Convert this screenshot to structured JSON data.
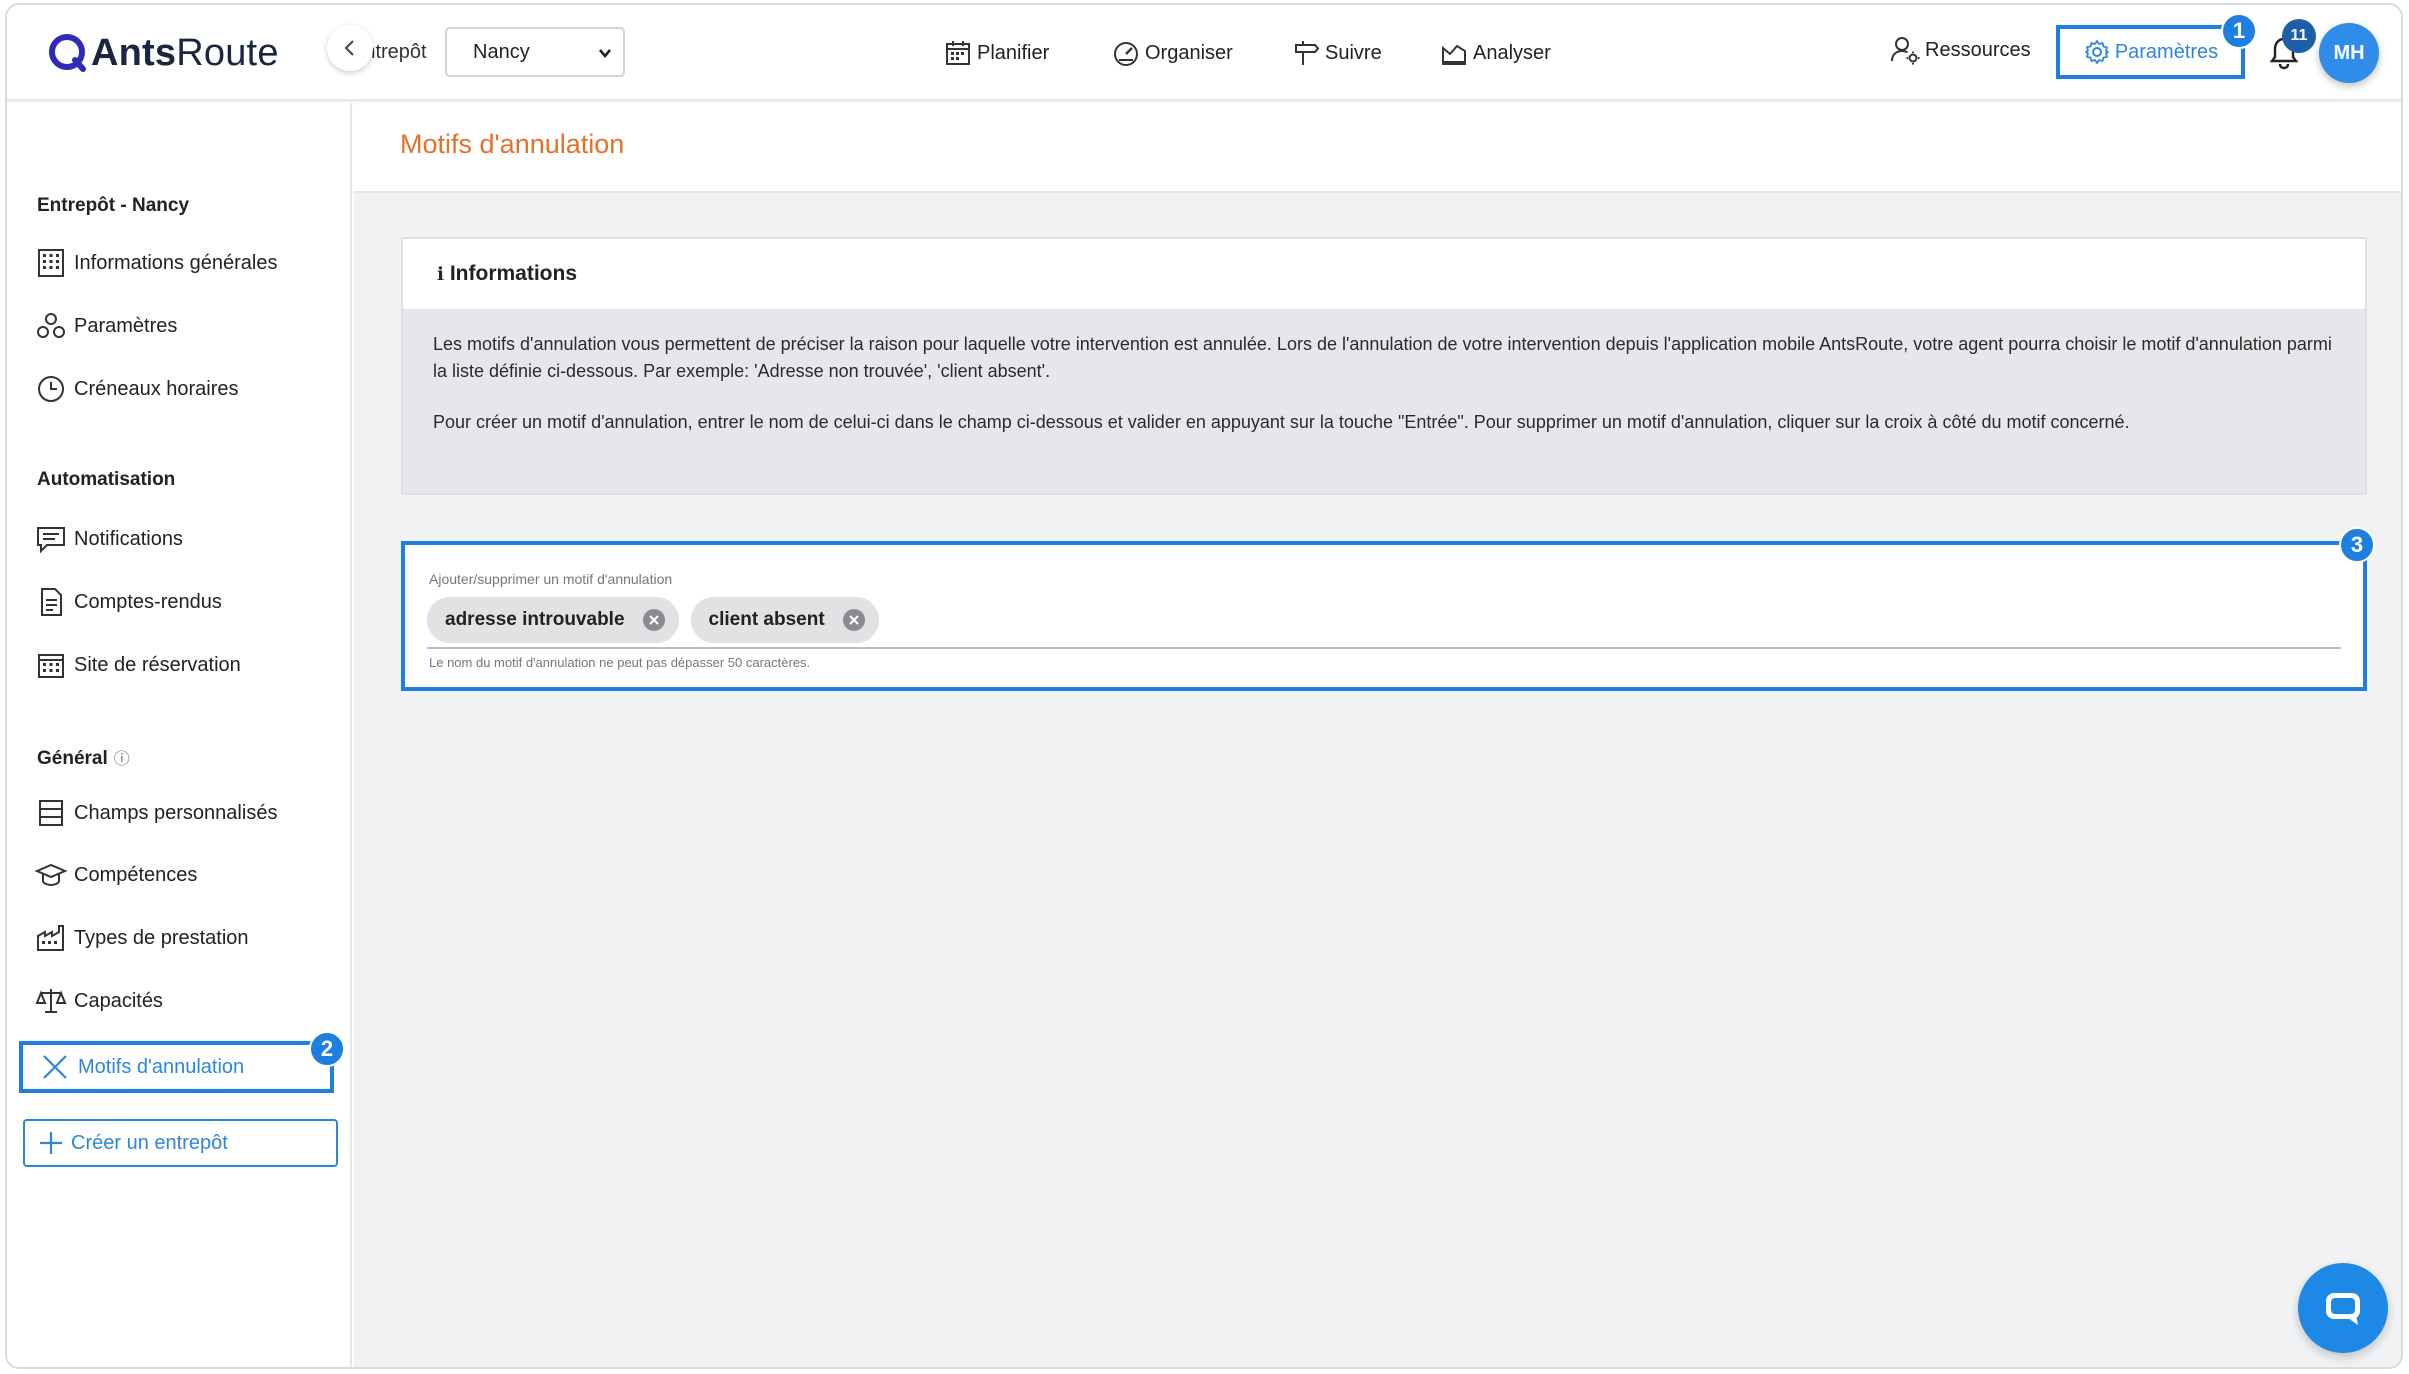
{
  "app": {
    "logo_bold": "Ants",
    "logo_light": "Route"
  },
  "header": {
    "warehouse_label": "Entrepôt",
    "warehouse_value": "Nancy",
    "nav": [
      "Planifier",
      "Organiser",
      "Suivre",
      "Analyser"
    ],
    "resources_label": "Ressources",
    "settings_label": "Paramètres",
    "settings_badge": "1",
    "notification_count": "11",
    "avatar_initials": "MH"
  },
  "sidebar": {
    "section_warehouse": "Entrepôt - Nancy",
    "warehouse_items": [
      "Informations générales",
      "Paramètres",
      "Créneaux horaires"
    ],
    "section_automation": "Automatisation",
    "automation_items": [
      "Notifications",
      "Comptes-rendus",
      "Site de réservation"
    ],
    "section_general": "Général",
    "general_items": [
      "Champs personnalisés",
      "Compétences",
      "Types de prestation",
      "Capacités",
      "Motifs d'annulation"
    ],
    "active_badge": "2",
    "create_button": "Créer un entrepôt"
  },
  "main": {
    "page_title": "Motifs d'annulation",
    "info_title": "Informations",
    "info_paragraph_1": "Les motifs d'annulation vous permettent de préciser la raison pour laquelle votre intervention est annulée. Lors de l'annulation de votre intervention depuis l'application mobile AntsRoute, votre agent pourra choisir le motif d'annulation parmi la liste définie ci-dessous. Par exemple: 'Adresse non trouvée', 'client absent'.",
    "info_paragraph_2": "Pour créer un motif d'annulation, entrer le nom de celui-ci dans le champ ci-dessous et valider en appuyant sur la touche \"Entrée\". Pour supprimer un motif d'annulation, cliquer sur la croix à côté du motif concerné.",
    "field_label": "Ajouter/supprimer un motif d'annulation",
    "chips": [
      "adresse introuvable",
      "client absent"
    ],
    "field_hint": "Le nom du motif d'annulation ne peut pas dépasser 50 caractères.",
    "field_badge": "3"
  },
  "colors": {
    "accent": "#1e7fe0",
    "title_orange": "#e8702a"
  }
}
